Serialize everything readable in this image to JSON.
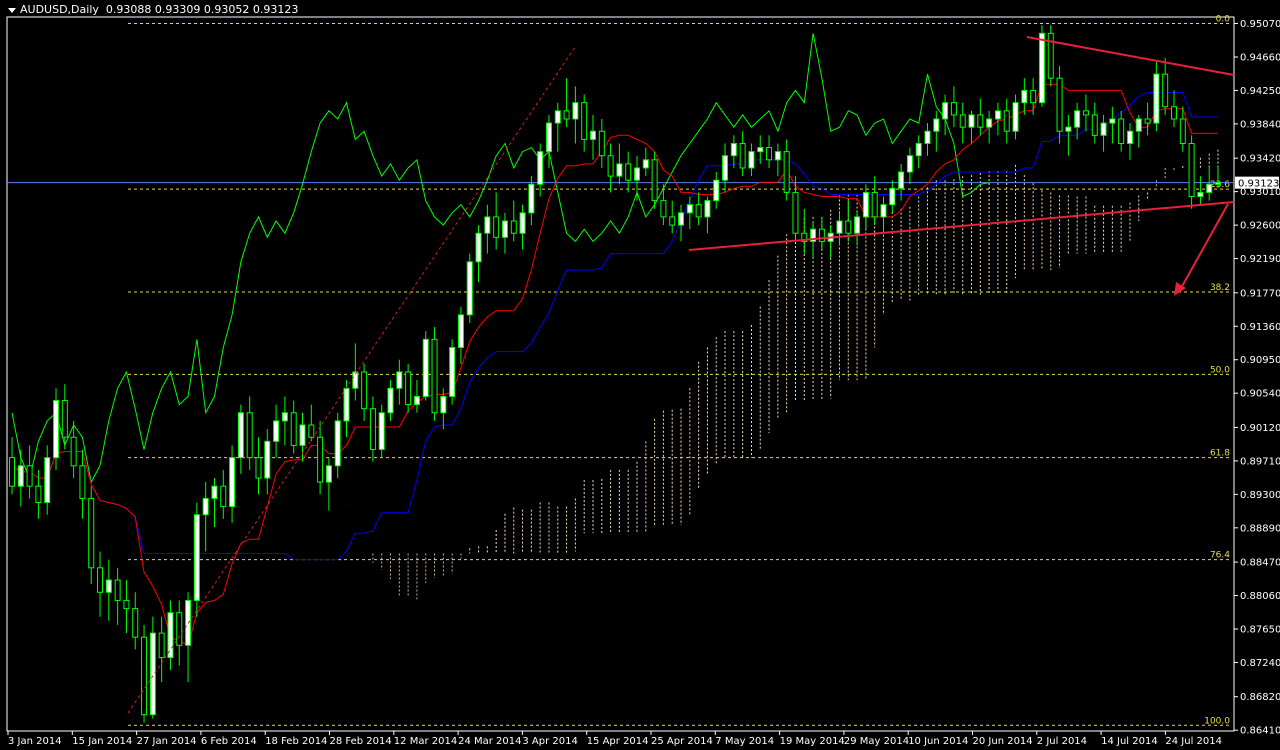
{
  "header": {
    "symbol": "AUDUSD,Daily",
    "ohlc": "0.93088 0.93309 0.93052 0.93123"
  },
  "colors": {
    "background": "#000000",
    "bull_candle": "#ffffff",
    "bear_candle": "#000000",
    "candle_outline": "#00ff00",
    "tenkan": "#ff0000",
    "kijun": "#0000ff",
    "chikou": "#00ff00",
    "kumo_a": "#f5deb3",
    "kumo_b": "#d2b48c",
    "fib": "#e0e040",
    "trendline": "#e8203a",
    "price_line": "#6080ff"
  },
  "price_label": "0.93123",
  "fib_levels": [
    {
      "label": "0.0",
      "price": 0.9507
    },
    {
      "label": "23.6",
      "price": 0.9304
    },
    {
      "label": "38.2",
      "price": 0.9178
    },
    {
      "label": "50.0",
      "price": 0.9077
    },
    {
      "label": "61.8",
      "price": 0.8975
    },
    {
      "label": "76.4",
      "price": 0.885
    },
    {
      "label": "100.0",
      "price": 0.8647
    }
  ],
  "chart_data": {
    "type": "candlestick",
    "ylim": [
      0.864,
      0.9515
    ],
    "y_ticks": [
      "0.95070",
      "0.94660",
      "0.94250",
      "0.93840",
      "0.93420",
      "0.93010",
      "0.92600",
      "0.92190",
      "0.91770",
      "0.91360",
      "0.90950",
      "0.90540",
      "0.90120",
      "0.89710",
      "0.89300",
      "0.88890",
      "0.88470",
      "0.88060",
      "0.87650",
      "0.87240",
      "0.86820",
      "0.86410"
    ],
    "x_ticks": [
      "3 Jan 2014",
      "15 Jan 2014",
      "27 Jan 2014",
      "6 Feb 2014",
      "18 Feb 2014",
      "28 Feb 2014",
      "12 Mar 2014",
      "24 Mar 2014",
      "3 Apr 2014",
      "15 Apr 2014",
      "25 Apr 2014",
      "7 May 2014",
      "19 May 2014",
      "29 May 2014",
      "10 Jun 2014",
      "20 Jun 2014",
      "2 Jul 2014",
      "14 Jul 2014",
      "24 Jul 2014"
    ],
    "candles": [
      [
        0.8975,
        0.9,
        0.893,
        0.894
      ],
      [
        0.894,
        0.8985,
        0.8915,
        0.8965
      ],
      [
        0.8965,
        0.899,
        0.8925,
        0.894
      ],
      [
        0.894,
        0.896,
        0.89,
        0.892
      ],
      [
        0.892,
        0.899,
        0.8905,
        0.8975
      ],
      [
        0.8975,
        0.906,
        0.896,
        0.9045
      ],
      [
        0.9045,
        0.9065,
        0.8985,
        0.9
      ],
      [
        0.9,
        0.902,
        0.895,
        0.8965
      ],
      [
        0.8965,
        0.8985,
        0.89,
        0.8925
      ],
      [
        0.8925,
        0.894,
        0.882,
        0.884
      ],
      [
        0.884,
        0.886,
        0.878,
        0.881
      ],
      [
        0.881,
        0.885,
        0.8775,
        0.8825
      ],
      [
        0.8825,
        0.884,
        0.877,
        0.88
      ],
      [
        0.88,
        0.8825,
        0.876,
        0.879
      ],
      [
        0.879,
        0.881,
        0.874,
        0.8755
      ],
      [
        0.8755,
        0.877,
        0.865,
        0.866
      ],
      [
        0.866,
        0.878,
        0.8655,
        0.876
      ],
      [
        0.876,
        0.878,
        0.87,
        0.873
      ],
      [
        0.873,
        0.88,
        0.8715,
        0.8785
      ],
      [
        0.8785,
        0.88,
        0.872,
        0.8745
      ],
      [
        0.8745,
        0.881,
        0.87,
        0.88
      ],
      [
        0.88,
        0.892,
        0.878,
        0.8905
      ],
      [
        0.8905,
        0.8945,
        0.886,
        0.8925
      ],
      [
        0.8925,
        0.895,
        0.889,
        0.894
      ],
      [
        0.894,
        0.896,
        0.89,
        0.8915
      ],
      [
        0.8915,
        0.899,
        0.8895,
        0.8975
      ],
      [
        0.8975,
        0.904,
        0.8955,
        0.903
      ],
      [
        0.903,
        0.905,
        0.896,
        0.8975
      ],
      [
        0.8975,
        0.9,
        0.893,
        0.895
      ],
      [
        0.895,
        0.901,
        0.893,
        0.8995
      ],
      [
        0.8995,
        0.904,
        0.8975,
        0.902
      ],
      [
        0.902,
        0.905,
        0.899,
        0.903
      ],
      [
        0.903,
        0.9045,
        0.898,
        0.899
      ],
      [
        0.899,
        0.903,
        0.897,
        0.9015
      ],
      [
        0.9015,
        0.904,
        0.8995,
        0.9
      ],
      [
        0.9,
        0.902,
        0.893,
        0.8945
      ],
      [
        0.8945,
        0.8975,
        0.891,
        0.8965
      ],
      [
        0.8965,
        0.903,
        0.895,
        0.902
      ],
      [
        0.902,
        0.907,
        0.9,
        0.906
      ],
      [
        0.906,
        0.9115,
        0.9045,
        0.908
      ],
      [
        0.908,
        0.909,
        0.902,
        0.9035
      ],
      [
        0.9035,
        0.905,
        0.897,
        0.8985
      ],
      [
        0.8985,
        0.904,
        0.8975,
        0.903
      ],
      [
        0.903,
        0.907,
        0.902,
        0.906
      ],
      [
        0.906,
        0.9095,
        0.904,
        0.908
      ],
      [
        0.908,
        0.909,
        0.903,
        0.904
      ],
      [
        0.904,
        0.907,
        0.903,
        0.905
      ],
      [
        0.905,
        0.913,
        0.9045,
        0.912
      ],
      [
        0.912,
        0.9135,
        0.902,
        0.903
      ],
      [
        0.903,
        0.906,
        0.901,
        0.905
      ],
      [
        0.905,
        0.912,
        0.904,
        0.911
      ],
      [
        0.911,
        0.916,
        0.909,
        0.915
      ],
      [
        0.915,
        0.9225,
        0.914,
        0.9215
      ],
      [
        0.9215,
        0.926,
        0.919,
        0.925
      ],
      [
        0.925,
        0.9285,
        0.9225,
        0.927
      ],
      [
        0.927,
        0.93,
        0.923,
        0.9245
      ],
      [
        0.9245,
        0.9275,
        0.9225,
        0.9265
      ],
      [
        0.9265,
        0.929,
        0.924,
        0.925
      ],
      [
        0.925,
        0.9285,
        0.923,
        0.9275
      ],
      [
        0.9275,
        0.932,
        0.926,
        0.931
      ],
      [
        0.931,
        0.936,
        0.9295,
        0.935
      ],
      [
        0.935,
        0.9395,
        0.933,
        0.9385
      ],
      [
        0.9385,
        0.941,
        0.935,
        0.94
      ],
      [
        0.94,
        0.944,
        0.938,
        0.939
      ],
      [
        0.939,
        0.943,
        0.936,
        0.941
      ],
      [
        0.941,
        0.942,
        0.935,
        0.9365
      ],
      [
        0.9365,
        0.9395,
        0.934,
        0.9375
      ],
      [
        0.9375,
        0.939,
        0.933,
        0.9345
      ],
      [
        0.9345,
        0.936,
        0.93,
        0.932
      ],
      [
        0.932,
        0.936,
        0.931,
        0.9335
      ],
      [
        0.9335,
        0.935,
        0.93,
        0.9315
      ],
      [
        0.9315,
        0.9345,
        0.929,
        0.933
      ],
      [
        0.933,
        0.9355,
        0.932,
        0.934
      ],
      [
        0.934,
        0.935,
        0.928,
        0.929
      ],
      [
        0.929,
        0.931,
        0.926,
        0.927
      ],
      [
        0.927,
        0.929,
        0.925,
        0.926
      ],
      [
        0.926,
        0.9285,
        0.924,
        0.9275
      ],
      [
        0.9275,
        0.9295,
        0.9255,
        0.9285
      ],
      [
        0.9285,
        0.93,
        0.926,
        0.927
      ],
      [
        0.927,
        0.9295,
        0.925,
        0.929
      ],
      [
        0.929,
        0.9325,
        0.928,
        0.9315
      ],
      [
        0.9315,
        0.936,
        0.93,
        0.9345
      ],
      [
        0.9345,
        0.937,
        0.933,
        0.936
      ],
      [
        0.936,
        0.9375,
        0.932,
        0.933
      ],
      [
        0.933,
        0.936,
        0.932,
        0.935
      ],
      [
        0.935,
        0.937,
        0.9335,
        0.9355
      ],
      [
        0.9355,
        0.937,
        0.933,
        0.934
      ],
      [
        0.934,
        0.936,
        0.932,
        0.935
      ],
      [
        0.935,
        0.9365,
        0.929,
        0.93
      ],
      [
        0.93,
        0.932,
        0.924,
        0.925
      ],
      [
        0.925,
        0.928,
        0.9225,
        0.924
      ],
      [
        0.924,
        0.9265,
        0.922,
        0.9255
      ],
      [
        0.9255,
        0.927,
        0.923,
        0.924
      ],
      [
        0.924,
        0.926,
        0.922,
        0.925
      ],
      [
        0.925,
        0.9275,
        0.9235,
        0.9265
      ],
      [
        0.9265,
        0.929,
        0.924,
        0.925
      ],
      [
        0.925,
        0.9275,
        0.9235,
        0.927
      ],
      [
        0.927,
        0.931,
        0.9255,
        0.93
      ],
      [
        0.93,
        0.932,
        0.926,
        0.927
      ],
      [
        0.927,
        0.9295,
        0.925,
        0.9285
      ],
      [
        0.9285,
        0.9315,
        0.9275,
        0.9305
      ],
      [
        0.9305,
        0.9335,
        0.929,
        0.9325
      ],
      [
        0.9325,
        0.9355,
        0.931,
        0.9345
      ],
      [
        0.9345,
        0.937,
        0.933,
        0.936
      ],
      [
        0.936,
        0.9385,
        0.9345,
        0.9375
      ],
      [
        0.9375,
        0.94,
        0.935,
        0.939
      ],
      [
        0.939,
        0.942,
        0.937,
        0.941
      ],
      [
        0.941,
        0.943,
        0.938,
        0.9395
      ],
      [
        0.9395,
        0.941,
        0.936,
        0.938
      ],
      [
        0.938,
        0.94,
        0.936,
        0.9395
      ],
      [
        0.9395,
        0.9415,
        0.937,
        0.938
      ],
      [
        0.938,
        0.94,
        0.936,
        0.939
      ],
      [
        0.939,
        0.941,
        0.937,
        0.94
      ],
      [
        0.94,
        0.9415,
        0.936,
        0.9375
      ],
      [
        0.9375,
        0.942,
        0.9365,
        0.941
      ],
      [
        0.941,
        0.944,
        0.9395,
        0.9425
      ],
      [
        0.9425,
        0.944,
        0.9395,
        0.941
      ],
      [
        0.941,
        0.9505,
        0.9405,
        0.9495
      ],
      [
        0.9495,
        0.9505,
        0.943,
        0.944
      ],
      [
        0.944,
        0.9455,
        0.936,
        0.9375
      ],
      [
        0.9375,
        0.9395,
        0.9345,
        0.938
      ],
      [
        0.938,
        0.941,
        0.9365,
        0.94
      ],
      [
        0.94,
        0.942,
        0.9375,
        0.9395
      ],
      [
        0.9395,
        0.941,
        0.936,
        0.937
      ],
      [
        0.937,
        0.9395,
        0.935,
        0.9385
      ],
      [
        0.9385,
        0.9405,
        0.936,
        0.939
      ],
      [
        0.939,
        0.94,
        0.935,
        0.936
      ],
      [
        0.936,
        0.9385,
        0.934,
        0.9375
      ],
      [
        0.9375,
        0.9395,
        0.9355,
        0.939
      ],
      [
        0.939,
        0.941,
        0.937,
        0.9385
      ],
      [
        0.9385,
        0.946,
        0.9375,
        0.9445
      ],
      [
        0.9445,
        0.9465,
        0.9395,
        0.9405
      ],
      [
        0.9405,
        0.9425,
        0.938,
        0.939
      ],
      [
        0.939,
        0.9405,
        0.935,
        0.936
      ],
      [
        0.936,
        0.937,
        0.928,
        0.9295
      ],
      [
        0.9295,
        0.932,
        0.9285,
        0.93
      ],
      [
        0.93,
        0.933,
        0.929,
        0.931
      ],
      [
        0.931,
        0.9331,
        0.9305,
        0.9312
      ]
    ]
  }
}
